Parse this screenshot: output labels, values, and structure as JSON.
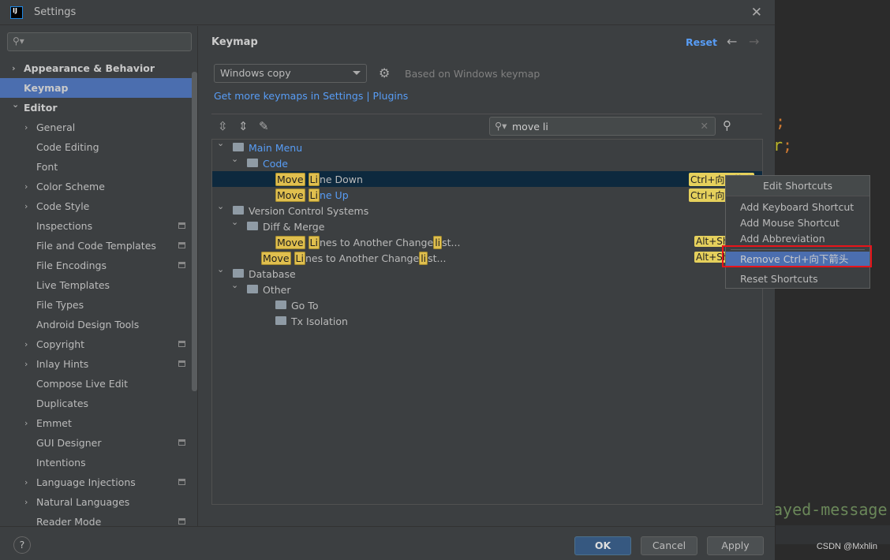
{
  "window": {
    "title": "Settings",
    "logo": "IJ"
  },
  "editor_bg": {
    "line1": ";",
    "line2_a": "r",
    "line2_b": ";",
    "line3": "ayed-message"
  },
  "watermark": "CSDN @Mxhlin",
  "sidebar": {
    "search_placeholder": "",
    "items": [
      {
        "label": "Appearance & Behavior",
        "level": 0,
        "chevron": "right",
        "bold": true
      },
      {
        "label": "Keymap",
        "level": 0,
        "bold": true,
        "selected": true
      },
      {
        "label": "Editor",
        "level": 0,
        "chevron": "down",
        "bold": true
      },
      {
        "label": "General",
        "level": 1,
        "chevron": "right"
      },
      {
        "label": "Code Editing",
        "level": 1
      },
      {
        "label": "Font",
        "level": 1
      },
      {
        "label": "Color Scheme",
        "level": 1,
        "chevron": "right"
      },
      {
        "label": "Code Style",
        "level": 1,
        "chevron": "right"
      },
      {
        "label": "Inspections",
        "level": 1,
        "marker": true
      },
      {
        "label": "File and Code Templates",
        "level": 1,
        "marker": true
      },
      {
        "label": "File Encodings",
        "level": 1,
        "marker": true
      },
      {
        "label": "Live Templates",
        "level": 1
      },
      {
        "label": "File Types",
        "level": 1
      },
      {
        "label": "Android Design Tools",
        "level": 1
      },
      {
        "label": "Copyright",
        "level": 1,
        "chevron": "right",
        "marker": true
      },
      {
        "label": "Inlay Hints",
        "level": 1,
        "chevron": "right",
        "marker": true
      },
      {
        "label": "Compose Live Edit",
        "level": 1
      },
      {
        "label": "Duplicates",
        "level": 1
      },
      {
        "label": "Emmet",
        "level": 1,
        "chevron": "right"
      },
      {
        "label": "GUI Designer",
        "level": 1,
        "marker": true
      },
      {
        "label": "Intentions",
        "level": 1
      },
      {
        "label": "Language Injections",
        "level": 1,
        "chevron": "right",
        "marker": true
      },
      {
        "label": "Natural Languages",
        "level": 1,
        "chevron": "right"
      },
      {
        "label": "Reader Mode",
        "level": 1,
        "marker": true
      }
    ]
  },
  "main": {
    "heading": "Keymap",
    "reset": "Reset",
    "keymap_select": "Windows copy",
    "based_on": "Based on Windows keymap",
    "links": "Get more keymaps in Settings | Plugins",
    "search_value": "move li",
    "tree": [
      {
        "label": "Main Menu",
        "level": 0,
        "chevron": "down",
        "icon": "menu-folder",
        "blue": true
      },
      {
        "label": "Code",
        "level": 1,
        "chevron": "down",
        "icon": "folder",
        "blue": true
      },
      {
        "hl1": "Move",
        "hl2": "Li",
        "rest": "ne Down",
        "level": 2,
        "selected": true,
        "shortcut": "Ctrl+向下箭头"
      },
      {
        "hl1": "Move",
        "hl2": "Li",
        "rest": "ne Up",
        "level": 2,
        "blue": true,
        "shortcut": "Ctrl+向上箭头"
      },
      {
        "label": "Version Control Systems",
        "level": 0,
        "chevron": "down",
        "icon": "folder"
      },
      {
        "label": "Diff & Merge",
        "level": 1,
        "chevron": "down",
        "icon": "folder"
      },
      {
        "hl1": "Move",
        "hl2": "Li",
        "rest": "nes to Another Change",
        "hl3": "li",
        "rest2": "st...",
        "level": 2,
        "shortcut": "Alt+Shift+M"
      },
      {
        "hl1": "Move",
        "hl2": "Li",
        "rest": "nes to Another Change",
        "hl3": "li",
        "rest2": "st...",
        "level": 1.1,
        "shortcut": "Alt+Shift+M"
      },
      {
        "label": "Database",
        "level": 0,
        "chevron": "down",
        "icon": "folder"
      },
      {
        "label": "Other",
        "level": 1,
        "chevron": "down",
        "icon": "folder"
      },
      {
        "label": "Go To",
        "level": 2,
        "icon": "folder"
      },
      {
        "label": "Tx Isolation",
        "level": 2,
        "icon": "folder"
      }
    ]
  },
  "context_menu": {
    "title": "Edit Shortcuts",
    "items": [
      "Add Keyboard Shortcut",
      "Add Mouse Shortcut",
      "Add Abbreviation",
      "Remove Ctrl+向下箭头",
      "Reset Shortcuts"
    ],
    "active_index": 3,
    "highlight_color": "#e8131a"
  },
  "footer": {
    "help": "?",
    "ok": "OK",
    "cancel": "Cancel",
    "apply": "Apply"
  }
}
